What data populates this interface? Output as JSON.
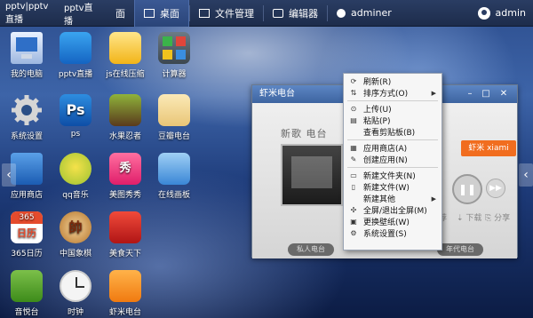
{
  "topbar": {
    "pptv_left": "pptv|pptv直播",
    "pptv_mid": "pptv直播",
    "tab_partial": "面",
    "tab_desktop": "桌面",
    "tab_files": "文件管理",
    "tab_editor": "编辑器",
    "tab_adminer": "adminer",
    "user": "admin"
  },
  "desktop_icons": [
    {
      "label": "我的电脑",
      "icon": "computer-icon"
    },
    {
      "label": "pptv直播",
      "icon": "pptv-icon"
    },
    {
      "label": "js在线压缩",
      "icon": "compress-icon"
    },
    {
      "label": "计算器",
      "icon": "calculator-icon"
    },
    {
      "label": "系统设置",
      "icon": "gear-icon"
    },
    {
      "label": "ps",
      "icon": "photoshop-icon"
    },
    {
      "label": "水果忍者",
      "icon": "fruit-ninja-icon"
    },
    {
      "label": "豆瓣电台",
      "icon": "douban-icon"
    },
    {
      "label": "应用商店",
      "icon": "store-icon"
    },
    {
      "label": "qq音乐",
      "icon": "qqmusic-icon"
    },
    {
      "label": "美图秀秀",
      "icon": "meitu-icon"
    },
    {
      "label": "在线画板",
      "icon": "paint-icon"
    },
    {
      "label": "365日历",
      "icon": "calendar-icon"
    },
    {
      "label": "中国象棋",
      "icon": "chess-icon"
    },
    {
      "label": "美食天下",
      "icon": "food-icon"
    },
    {
      "label": "音悦台",
      "icon": "yinyuetai-icon"
    },
    {
      "label": "时钟",
      "icon": "clock-icon"
    },
    {
      "label": "虾米电台",
      "icon": "xiami-icon"
    }
  ],
  "window": {
    "title": "虾米电台",
    "player_title": "新歌  电台",
    "badge": "虾米 xiami",
    "action_download": "下载",
    "action_share": "分享",
    "action_partial": "荐",
    "buttons": [
      "私人电台",
      "",
      "",
      "年代电台"
    ]
  },
  "context_menu": {
    "items": [
      {
        "label": "刷新(R)",
        "icon": "refresh-icon",
        "submenu": false
      },
      {
        "label": "排序方式(O)",
        "icon": "sort-icon",
        "submenu": true
      },
      {
        "sep": true
      },
      {
        "label": "上传(U)",
        "icon": "upload-icon",
        "submenu": false
      },
      {
        "label": "粘贴(P)",
        "icon": "paste-icon",
        "submenu": false
      },
      {
        "label": "查看剪贴板(B)",
        "icon": "clipboard-icon",
        "submenu": false
      },
      {
        "sep": true
      },
      {
        "label": "应用商店(A)",
        "icon": "store-icon",
        "submenu": false
      },
      {
        "label": "创建应用(N)",
        "icon": "create-app-icon",
        "submenu": false
      },
      {
        "sep": true
      },
      {
        "label": "新建文件夹(N)",
        "icon": "folder-icon",
        "submenu": false
      },
      {
        "label": "新建文件(W)",
        "icon": "file-icon",
        "submenu": false
      },
      {
        "label": "新建其他",
        "icon": "new-other-icon",
        "submenu": true
      },
      {
        "label": "全屏/退出全屏(M)",
        "icon": "fullscreen-icon",
        "submenu": false
      },
      {
        "label": "更换壁纸(W)",
        "icon": "wallpaper-icon",
        "submenu": false
      },
      {
        "label": "系统设置(S)",
        "icon": "settings-icon",
        "submenu": false
      }
    ]
  }
}
